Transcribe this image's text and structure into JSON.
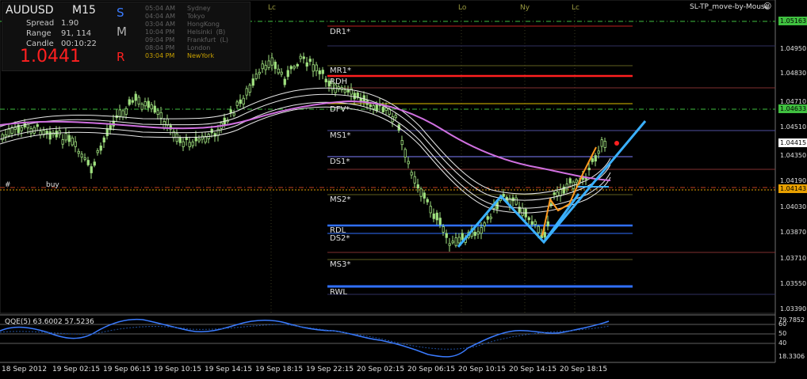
{
  "symbol": "AUDUSD",
  "timeframe": "M15",
  "info": {
    "spread_label": "Spread",
    "spread_value": "1.90",
    "range_label": "Range",
    "range_value": "91, 114",
    "candle_label": "Candle",
    "candle_value": "00:10:22",
    "bid": "1.0441"
  },
  "smr_letters": [
    {
      "letter": "S",
      "color": "#3a7bff"
    },
    {
      "letter": "M",
      "color": "#b0b0b0"
    },
    {
      "letter": "R",
      "color": "#ff2020"
    }
  ],
  "sessions": [
    {
      "time": "05:04 AM",
      "name": "Sydney",
      "color": "#606060"
    },
    {
      "time": "04:04 AM",
      "name": "Tokyo",
      "color": "#606060"
    },
    {
      "time": "03:04 AM",
      "name": "HongKong",
      "color": "#606060"
    },
    {
      "time": "10:04 PM",
      "name": "Helsinki  (B)",
      "color": "#606060"
    },
    {
      "time": "09:04 PM",
      "name": "Frankfurt  (L)",
      "color": "#606060"
    },
    {
      "time": "08:04 PM",
      "name": "London",
      "color": "#606060"
    },
    {
      "time": "03:04 PM",
      "name": "NewYork",
      "color": "#c8a000"
    }
  ],
  "indicator_title": "SL-TP_move-by-Mouse",
  "price_axis": [
    "1.04950",
    "1.04830",
    "1.04710",
    "1.04510",
    "1.04350",
    "1.04190",
    "1.04030",
    "1.03870",
    "1.03710",
    "1.03550",
    "1.03390"
  ],
  "price_boxes": [
    {
      "text": "1.05163",
      "color": "#40c040"
    },
    {
      "text": "1.04633",
      "color": "#40c040"
    },
    {
      "text": "1.04415",
      "color": "#ffffff"
    },
    {
      "text": "1.04143",
      "color": "#e8a000"
    }
  ],
  "pivot_levels": [
    {
      "name": "DR1*",
      "color": "#c02020"
    },
    {
      "name": "MR1*",
      "color": "#ff2020"
    },
    {
      "name": "RDH",
      "color": "#ffffff"
    },
    {
      "name": "DFV*",
      "color": "#e0c000"
    },
    {
      "name": "MS1*",
      "color": "#8080ff"
    },
    {
      "name": "DS1*",
      "color": "#8080ff"
    },
    {
      "name": "MS2*",
      "color": "#808040"
    },
    {
      "name": "RDL",
      "color": "#3070ff"
    },
    {
      "name": "DS2*",
      "color": "#3070ff"
    },
    {
      "name": "MS3*",
      "color": "#808040"
    },
    {
      "name": "RWL",
      "color": "#3070ff"
    }
  ],
  "session_markers": [
    "Lc",
    "Lo",
    "Ny",
    "Lc"
  ],
  "chart_markers": {
    "hash": "#",
    "buy": "buy"
  },
  "time_axis": [
    "18 Sep 2012",
    "19 Sep 02:15",
    "19 Sep 06:15",
    "19 Sep 10:15",
    "19 Sep 14:15",
    "19 Sep 18:15",
    "19 Sep 22:15",
    "20 Sep 02:15",
    "20 Sep 06:15",
    "20 Sep 10:15",
    "20 Sep 14:15",
    "20 Sep 18:15"
  ],
  "qqe": {
    "label": "QQE(5) 63.6002 57.5236",
    "axis_max": "79.7852",
    "axis_min": "18.3306",
    "levels": [
      "60",
      "50",
      "40"
    ]
  },
  "colors": {
    "candle": "#9fe07f",
    "ma_purple": "#d070e0",
    "ma_white": "#e8e8e8",
    "trend_blue": "#3ab0ff",
    "trend_orange": "#ff9a20",
    "qqe_line": "#3a7bff"
  }
}
